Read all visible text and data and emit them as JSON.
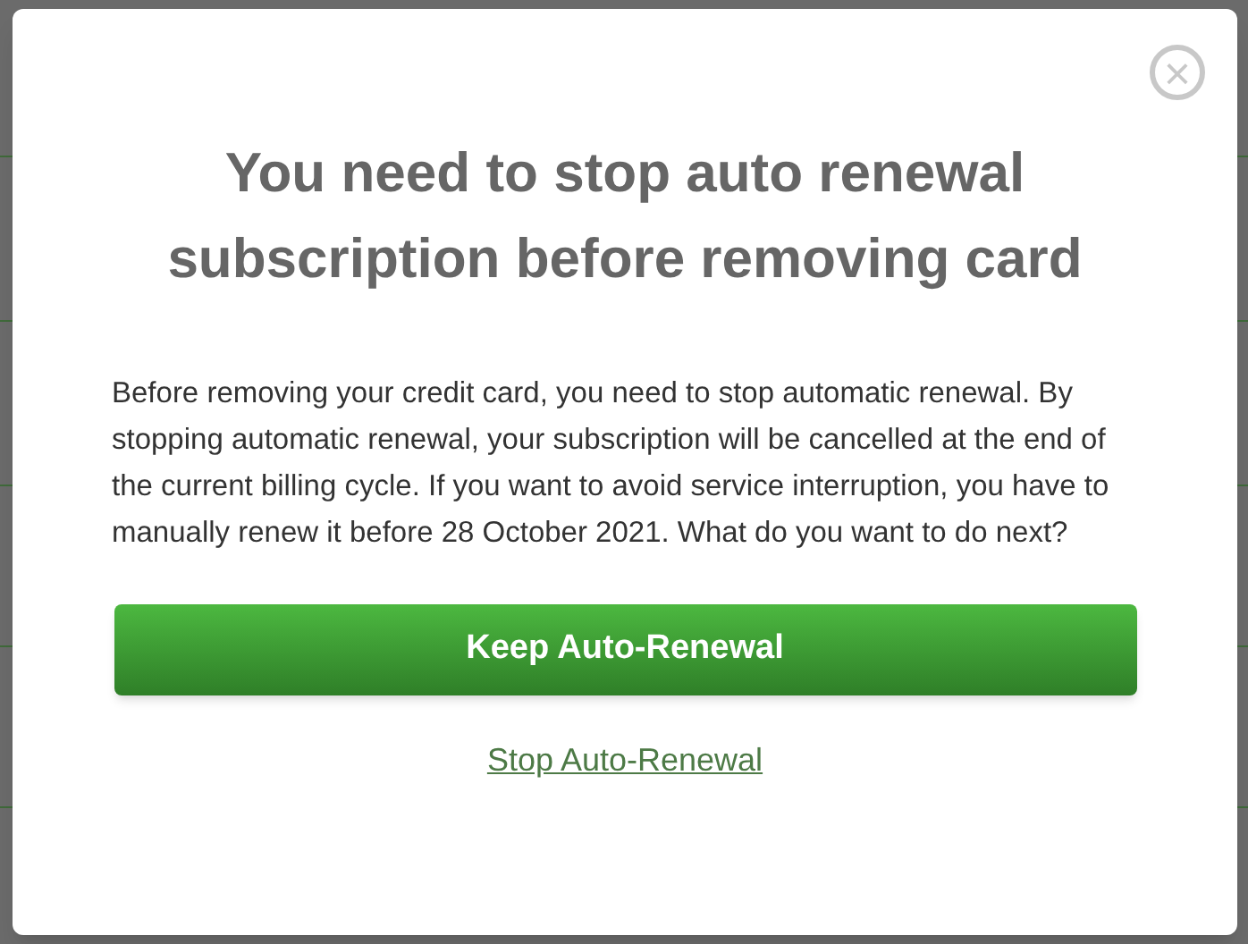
{
  "dialog": {
    "close": "×",
    "title": "You need to stop auto renewal subscription before removing card",
    "message": "Before removing your credit card, you need to stop automatic renewal. By stopping automatic renewal, your subscription will be cancelled at the end of the current billing cycle. If you want to avoid service interruption, you have to manually renew it before 28 October 2021. What do you want to do next?",
    "primary_button": "Keep Auto-Renewal",
    "secondary_link": "Stop Auto-Renewal"
  }
}
